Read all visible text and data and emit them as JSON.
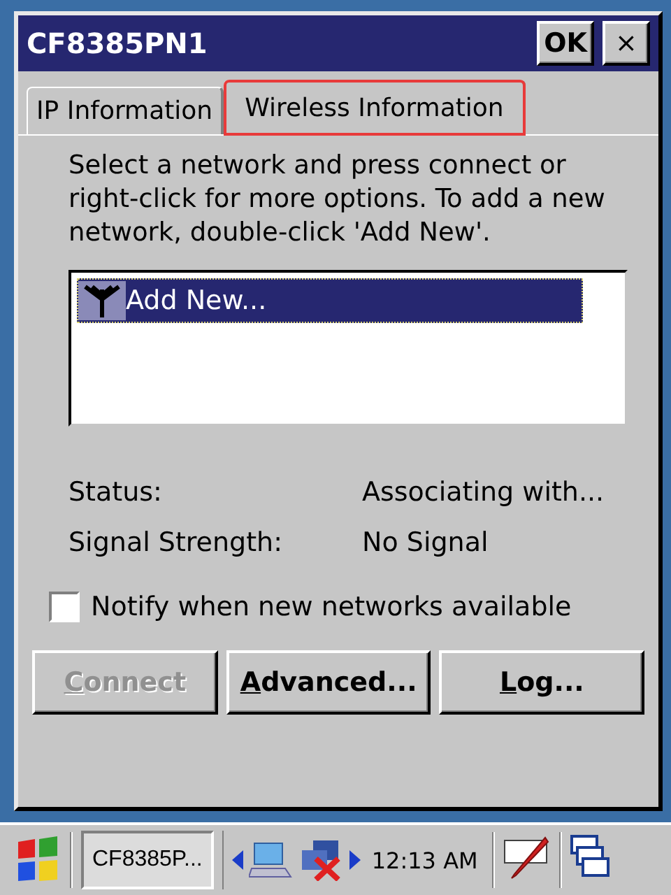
{
  "window": {
    "title": "CF8385PN1",
    "ok_button": "OK",
    "close_button": "×"
  },
  "tabs": [
    {
      "label": "IP Information",
      "selected": false,
      "highlighted": false
    },
    {
      "label": "Wireless Information",
      "selected": true,
      "highlighted": true
    }
  ],
  "instructions": "Select a network and press connect or right-click for more options.  To add a new network, double-click 'Add New'.",
  "networks": [
    {
      "label": "Add New...",
      "selected": true
    }
  ],
  "info": [
    {
      "label": "Status:",
      "value": "Associating with..."
    },
    {
      "label": "Signal Strength:",
      "value": "No Signal"
    }
  ],
  "notify": {
    "label": "Notify when new networks available",
    "checked": false
  },
  "buttons": [
    {
      "accel": "C",
      "rest": "onnect",
      "disabled": true
    },
    {
      "accel": "A",
      "rest": "dvanced...",
      "disabled": false
    },
    {
      "accel": "L",
      "rest": "og...",
      "disabled": false
    }
  ],
  "taskbar": {
    "task": "CF8385P...",
    "time": "12:13 AM"
  }
}
